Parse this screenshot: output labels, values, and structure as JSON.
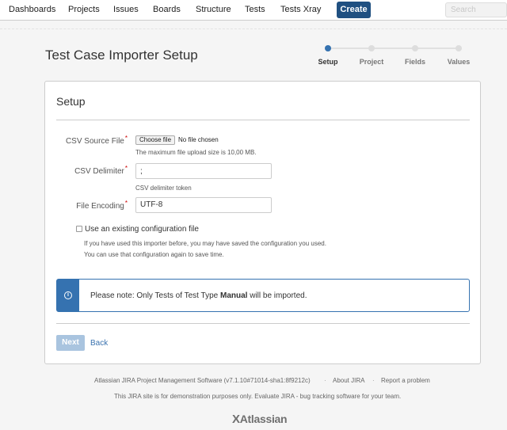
{
  "nav": {
    "items": [
      "Dashboards",
      "Projects",
      "Issues",
      "Boards",
      "Structure",
      "Tests",
      "Tests Xray"
    ],
    "create_label": "Create",
    "search_placeholder": "Search"
  },
  "page": {
    "title": "Test Case Importer Setup"
  },
  "progress": {
    "steps": [
      "Setup",
      "Project",
      "Fields",
      "Values"
    ],
    "current_index": 0
  },
  "form": {
    "title": "Setup",
    "csv_source": {
      "label": "CSV Source File",
      "button": "Choose file",
      "status": "No file chosen",
      "help": "The maximum file upload size is 10,00 MB."
    },
    "delimiter": {
      "label": "CSV Delimiter",
      "value": ";",
      "help": "CSV delimiter token"
    },
    "encoding": {
      "label": "File Encoding",
      "value": "UTF-8"
    },
    "existing_config": {
      "label": "Use an existing configuration file",
      "help_line1": "If you have used this importer before, you may have saved the configuration you used.",
      "help_line2": "You can use that configuration again to save time."
    },
    "required_mark": "*",
    "note": {
      "prefix": "Please note: Only Tests of Test Type ",
      "emphasis": "Manual",
      "suffix": " will be imported.",
      "icon": "info-icon"
    },
    "next_label": "Next",
    "back_label": "Back"
  },
  "footer": {
    "software": "Atlassian JIRA Project Management Software (v7.1.10#71014-sha1:8f9212c)",
    "separator": "·",
    "about": "About JIRA",
    "report": "Report a problem",
    "notice": "This JIRA site is for demonstration purposes only. Evaluate JIRA - bug tracking software for your team.",
    "logo_mark": "X",
    "logo_text": "Atlassian"
  },
  "colors": {
    "brand": "#205081",
    "accent": "#3572b0",
    "link": "#3b73af",
    "disabled_button": "#a9c4df"
  }
}
